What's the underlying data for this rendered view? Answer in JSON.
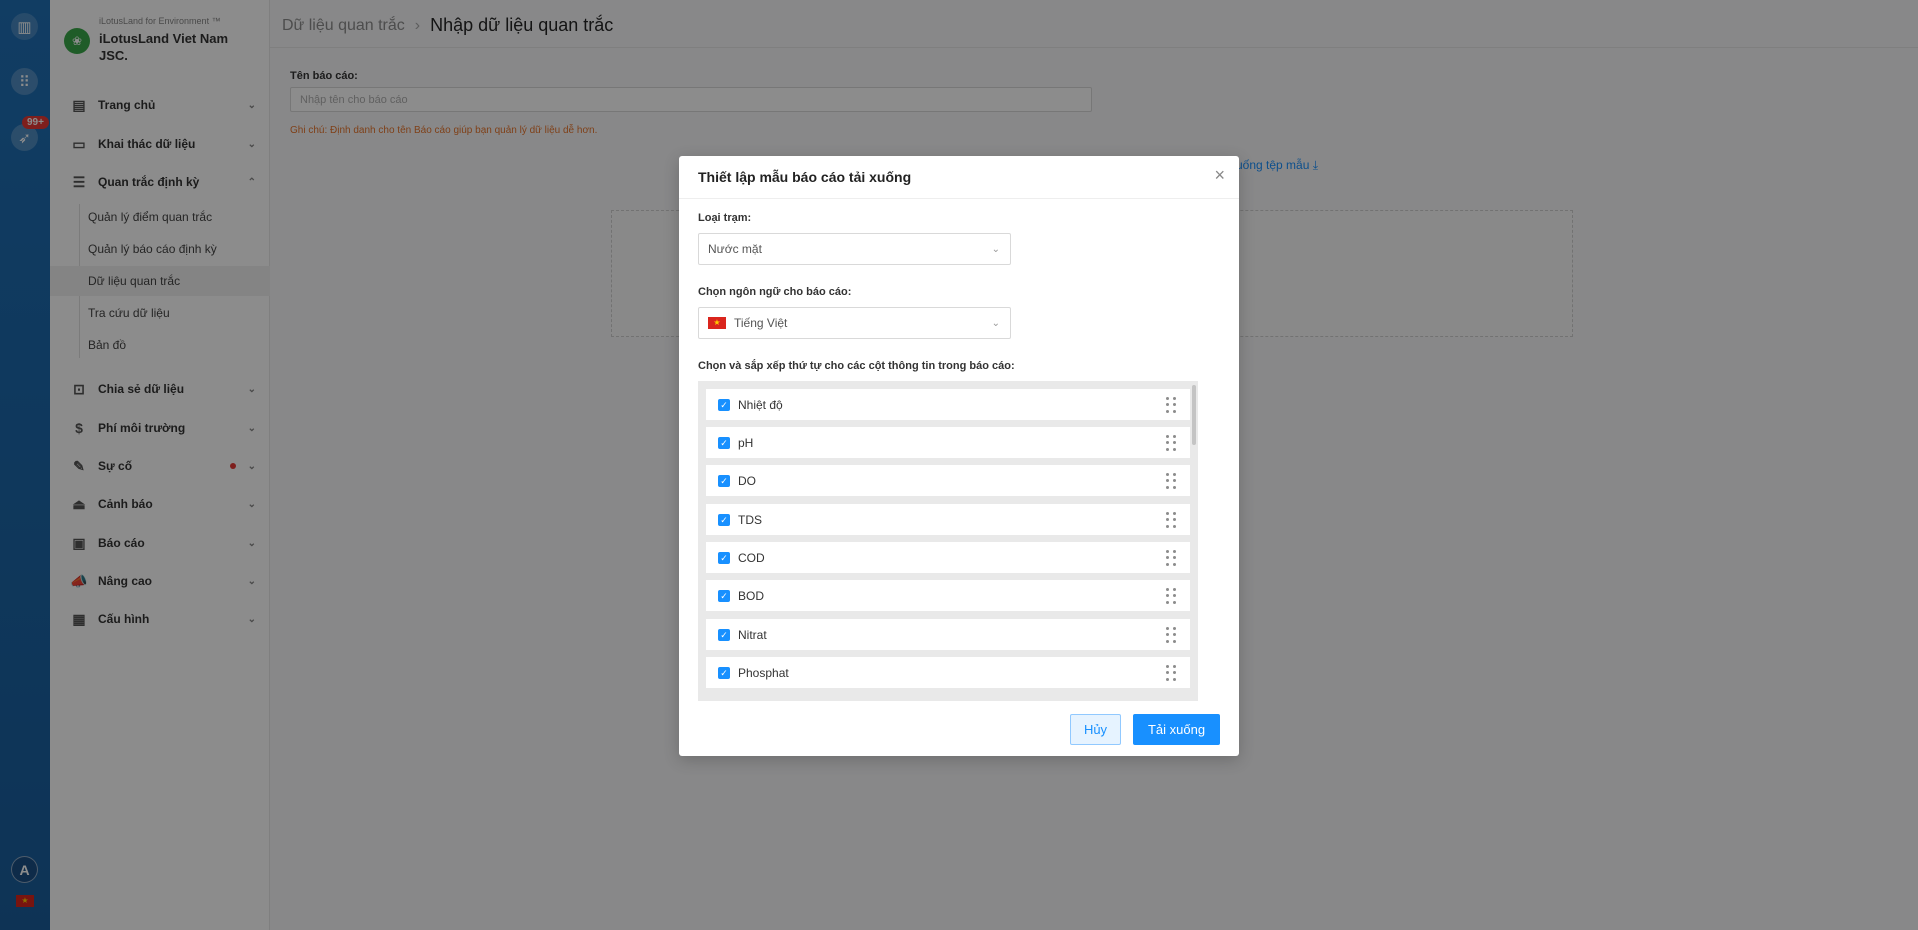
{
  "rail": {
    "badge": "99+",
    "avatar": "A"
  },
  "brand": {
    "subtitle": "iLotusLand for Environment ™",
    "name": "iLotusLand Viet Nam JSC."
  },
  "sidebar": {
    "items": [
      {
        "label": "Trang chủ",
        "icon": "layout-icon"
      },
      {
        "label": "Khai thác dữ liệu",
        "icon": "monitor-icon"
      },
      {
        "label": "Quan trắc định kỳ",
        "icon": "list-icon"
      },
      {
        "label": "Chia sẻ dữ liệu",
        "icon": "share-icon"
      },
      {
        "label": "Phí môi trường",
        "icon": "dollar-icon"
      },
      {
        "label": "Sự cố",
        "icon": "edit-icon"
      },
      {
        "label": "Cảnh báo",
        "icon": "alarm-icon"
      },
      {
        "label": "Báo cáo",
        "icon": "report-icon"
      },
      {
        "label": "Nâng cao",
        "icon": "megaphone-icon"
      },
      {
        "label": "Cấu hình",
        "icon": "config-icon"
      }
    ],
    "sub_items": [
      "Quản lý điểm quan trắc",
      "Quản lý báo cáo định kỳ",
      "Dữ liệu quan trắc",
      "Tra cứu dữ liệu",
      "Bản đồ"
    ]
  },
  "breadcrumb": {
    "parent": "Dữ liệu quan trắc",
    "current": "Nhập dữ liệu quan trắc"
  },
  "form": {
    "label": "Tên báo cáo:",
    "placeholder": "Nhập tên cho báo cáo",
    "hint": "Ghi chú: Định danh cho tên Báo cáo giúp bạn quản lý dữ liệu dễ hơn.",
    "download_sample": "xuống tệp mẫu ⤓"
  },
  "modal": {
    "title": "Thiết lập mẫu báo cáo tải xuống",
    "station_label": "Loại trạm:",
    "station_value": "Nước mặt",
    "language_label": "Chọn ngôn ngữ cho báo cáo:",
    "language_value": "Tiếng Việt",
    "columns_label": "Chọn và sắp xếp thứ tự cho các cột thông tin trong báo cáo:",
    "columns": [
      "Nhiệt độ",
      "pH",
      "DO",
      "TDS",
      "COD",
      "BOD",
      "Nitrat",
      "Phosphat"
    ],
    "cancel": "Hủy",
    "download": "Tải xuống"
  }
}
